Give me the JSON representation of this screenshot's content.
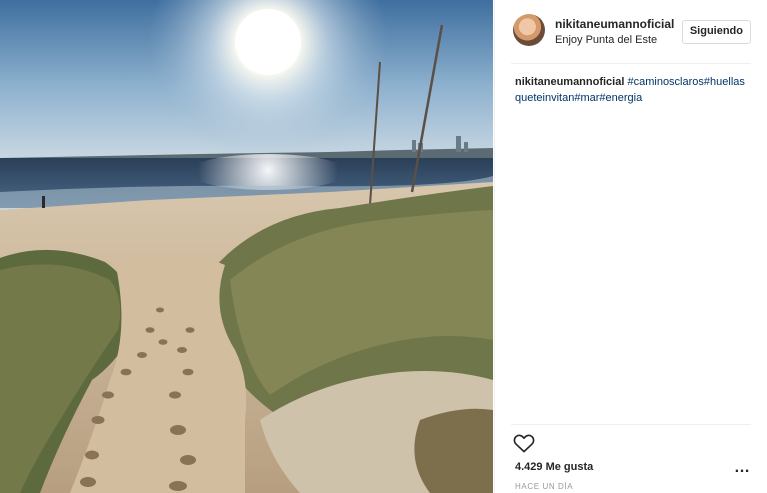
{
  "post": {
    "username": "nikitaneumannoficial",
    "location": "Enjoy Punta del Este",
    "follow_label": "Siguiendo",
    "caption": {
      "username": "nikitaneumannoficial",
      "hashtags": [
        "#caminosclaros",
        "#huellas queteinvitan",
        "#mar",
        "#energia"
      ]
    },
    "likes_text": "4.429 Me gusta",
    "timestamp": "HACE UN DÍA",
    "more_label": "…"
  },
  "icons": {
    "heart": "heart-outline-icon",
    "more": "more-options-icon",
    "avatar": "avatar"
  },
  "colors": {
    "hashtag": "#003569",
    "text": "#262626",
    "muted": "#999999",
    "border": "#dbdbdb"
  }
}
